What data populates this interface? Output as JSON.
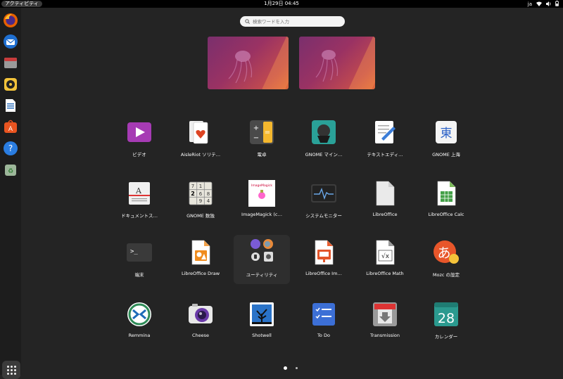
{
  "topbar": {
    "activities": "アクティビティ",
    "clock": "1月29日  04:45",
    "lang": "ja"
  },
  "dock": {
    "items": [
      "firefox-icon",
      "thunderbird-icon",
      "files-icon",
      "rhythmbox-icon",
      "writer-icon",
      "software-icon",
      "help-icon",
      "trash-icon"
    ]
  },
  "search": {
    "placeholder": "検索ワードを入力"
  },
  "apps": [
    {
      "label": "ビデオ",
      "icon": "videos-icon"
    },
    {
      "label": "AisleRiot ソリテ…",
      "icon": "aisleriot-icon"
    },
    {
      "label": "電卓",
      "icon": "calculator-icon"
    },
    {
      "label": "GNOME マイン…",
      "icon": "mines-icon"
    },
    {
      "label": "テキストエディ…",
      "icon": "text-editor-icon"
    },
    {
      "label": "GNOME 上海",
      "icon": "mahjongg-icon"
    },
    {
      "label": "ドキュメントス…",
      "icon": "document-scanner-icon"
    },
    {
      "label": "GNOME 数独",
      "icon": "sudoku-icon"
    },
    {
      "label": "ImageMagick (c…",
      "icon": "imagemagick-icon"
    },
    {
      "label": "システムモニター",
      "icon": "system-monitor-icon"
    },
    {
      "label": "LibreOffice",
      "icon": "libreoffice-icon"
    },
    {
      "label": "LibreOffice Calc",
      "icon": "libreoffice-calc-icon"
    },
    {
      "label": "端末",
      "icon": "terminal-icon"
    },
    {
      "label": "LibreOffice Draw",
      "icon": "libreoffice-draw-icon"
    },
    {
      "label": "ユーティリティ",
      "icon": "utilities-folder-icon"
    },
    {
      "label": "LibreOffice Im…",
      "icon": "libreoffice-impress-icon"
    },
    {
      "label": "LibreOffice Math",
      "icon": "libreoffice-math-icon"
    },
    {
      "label": "Mozc の設定",
      "icon": "mozc-icon"
    },
    {
      "label": "Remmina",
      "icon": "remmina-icon"
    },
    {
      "label": "Cheese",
      "icon": "cheese-icon"
    },
    {
      "label": "Shotwell",
      "icon": "shotwell-icon"
    },
    {
      "label": "To Do",
      "icon": "todo-icon"
    },
    {
      "label": "Transmission",
      "icon": "transmission-icon"
    },
    {
      "label": "カレンダー",
      "icon": "calendar-icon"
    }
  ],
  "glyphs": {
    "calendar_day": "28",
    "mahjongg": "東",
    "mozc": "あ",
    "sudoku": [
      "7",
      "1",
      "2",
      "6",
      "8",
      "9",
      "4"
    ],
    "math": "√x",
    "terminal": ">_",
    "imagemagick": "ImageMagick"
  },
  "pager": {
    "pages": 2,
    "current": 1
  }
}
